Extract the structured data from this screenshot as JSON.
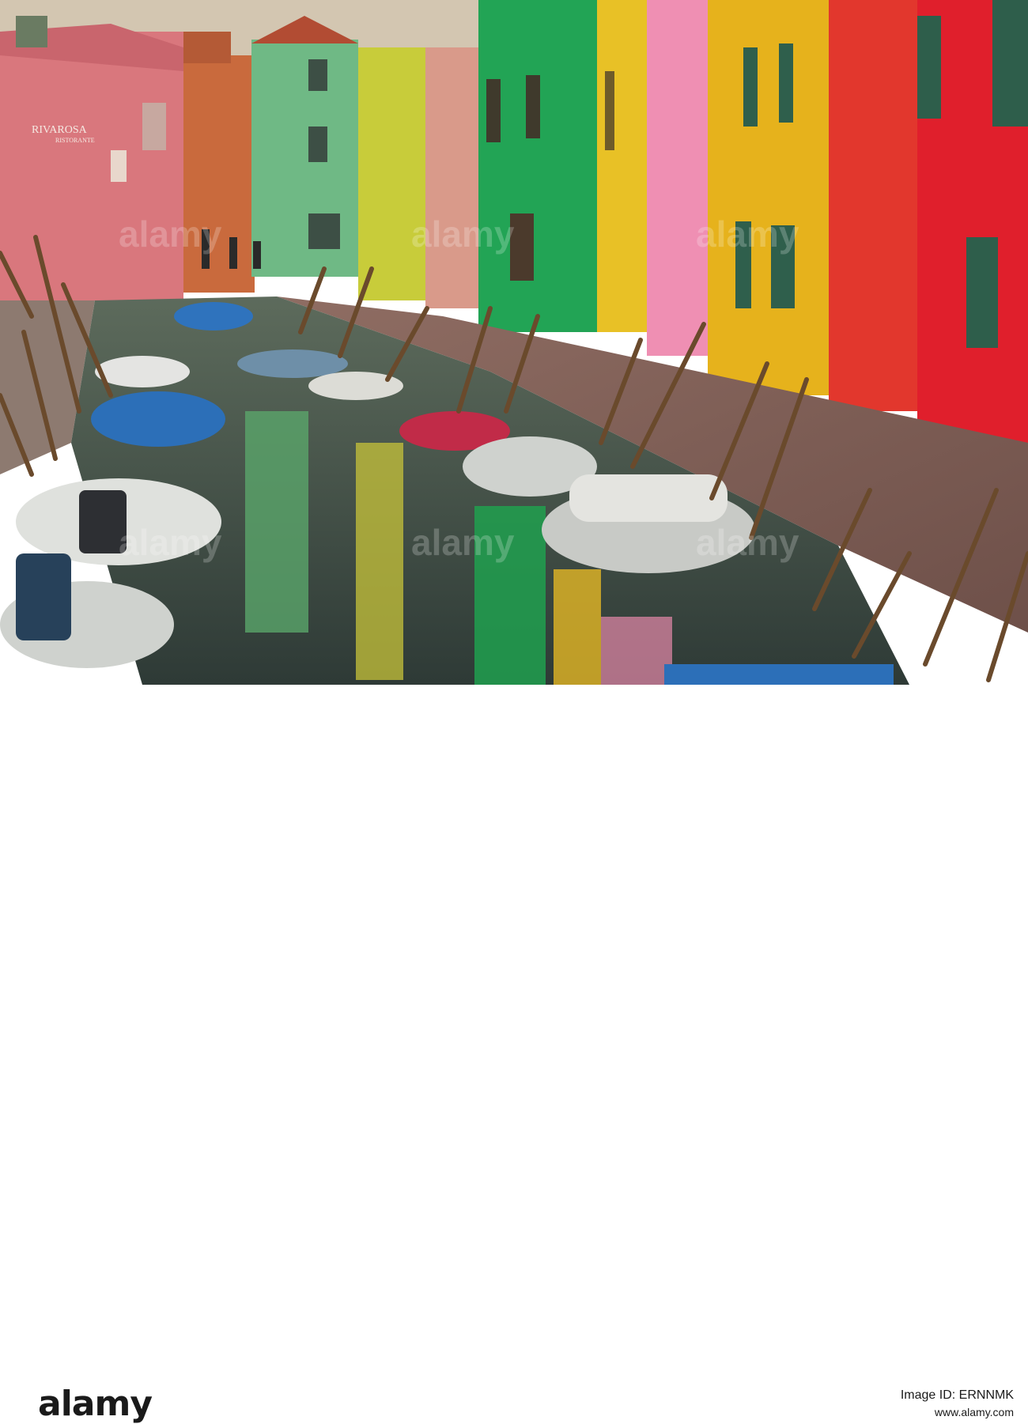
{
  "image": {
    "description_visible_text": {
      "shop_sign_name": "RIVAROSA",
      "shop_sign_sub": "RISTORANTE"
    },
    "watermark_text": "alamy"
  },
  "banner": {
    "logo_text": "alamy",
    "image_id_label": "Image ID: ERNNMK",
    "site_url": "www.alamy.com"
  },
  "colors": {
    "sky": "#d7cfc0",
    "pink_house": "#d96f77",
    "green_house": "#2ea95a",
    "yellow_house": "#e5b51f",
    "red_house": "#e0202b",
    "water": "#3c4b45",
    "banner_bg": "#ffffff"
  }
}
